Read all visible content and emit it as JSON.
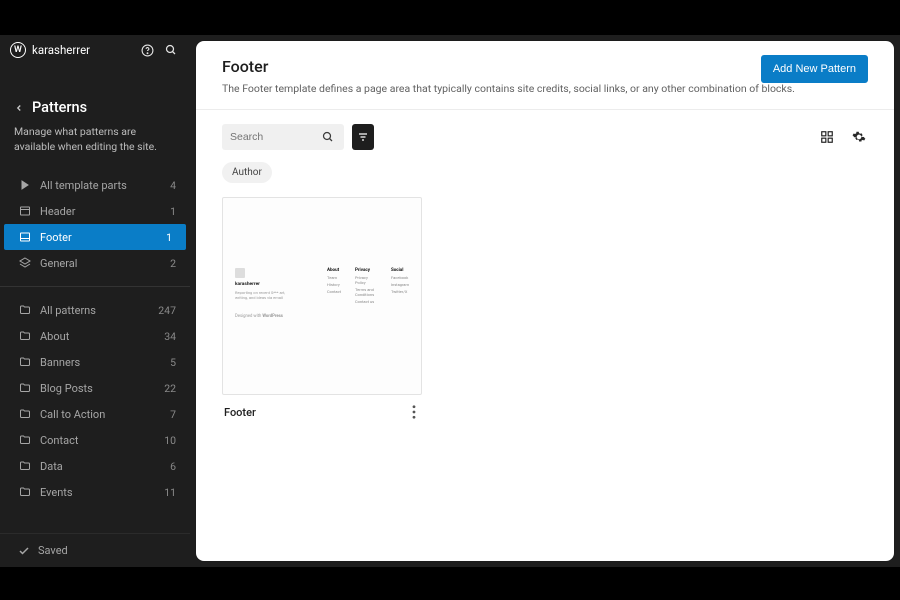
{
  "topbar": {
    "site_name": "karasherrer"
  },
  "sidebar": {
    "title": "Patterns",
    "description": "Manage what patterns are available when editing the site.",
    "template_parts": [
      {
        "label": "All template parts",
        "count": "4",
        "icon": "grid"
      },
      {
        "label": "Header",
        "count": "1",
        "icon": "header"
      },
      {
        "label": "Footer",
        "count": "1",
        "icon": "footer",
        "active": true
      },
      {
        "label": "General",
        "count": "2",
        "icon": "layers"
      }
    ],
    "pattern_cats": [
      {
        "label": "All patterns",
        "count": "247"
      },
      {
        "label": "About",
        "count": "34"
      },
      {
        "label": "Banners",
        "count": "5"
      },
      {
        "label": "Blog Posts",
        "count": "22"
      },
      {
        "label": "Call to Action",
        "count": "7"
      },
      {
        "label": "Contact",
        "count": "10"
      },
      {
        "label": "Data",
        "count": "6"
      },
      {
        "label": "Events",
        "count": "11"
      }
    ],
    "saved": "Saved"
  },
  "main": {
    "title": "Footer",
    "description": "The Footer template defines a page area that typically contains site credits, social links, or any other combination of blocks.",
    "add_button": "Add New Pattern",
    "search_placeholder": "Search",
    "chip": "Author",
    "card_title": "Footer"
  }
}
